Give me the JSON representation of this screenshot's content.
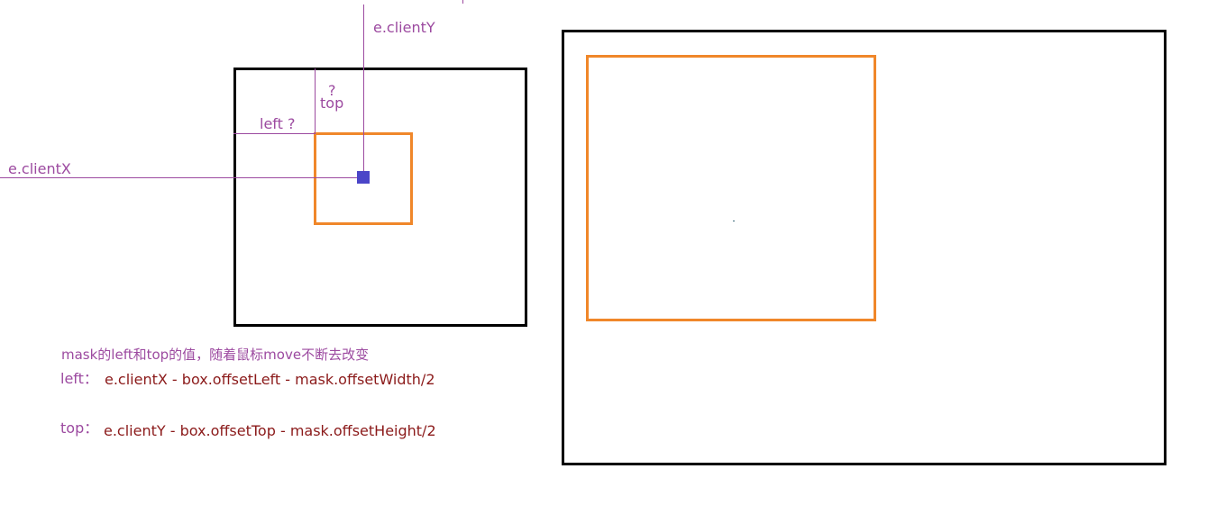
{
  "diagram": {
    "labels": {
      "client_y": "e.clientY",
      "client_x": "e.clientX",
      "question_mark": "?",
      "top": "top",
      "left_question": "left ?"
    },
    "note": {
      "description": "mask的left和top的值，随着鼠标move不断去改变",
      "left_label": "left：",
      "left_formula": "e.clientX - box.offsetLeft - mask.offsetWidth/2",
      "top_label": "top：",
      "top_formula": "e.clientY - box.offsetTop - mask.offsetHeight/2"
    },
    "colors": {
      "box_border": "#000000",
      "mask_border": "#f0872a",
      "guide_line": "#9c4aa0",
      "label_text": "#9c4aa0",
      "formula_text": "#8b1a1a",
      "cursor": "#4b45c8"
    }
  }
}
